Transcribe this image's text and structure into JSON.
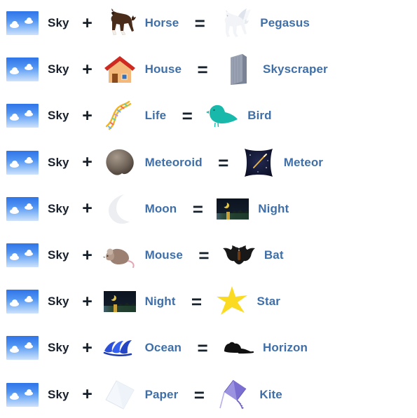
{
  "page": {
    "background_color": "#ffffff",
    "base_text_color": "#17202b",
    "link_text_color": "#3f6fa8",
    "operator_plus": "+",
    "operator_equals": "=",
    "base_element_label": "Sky",
    "base_element_icon": "sky-icon"
  },
  "recipes": [
    {
      "left_label": "Sky",
      "left_icon": "sky-icon",
      "plus": "+",
      "right_label": "Horse",
      "right_icon": "horse-icon",
      "equals": "=",
      "result_label": "Pegasus",
      "result_icon": "pegasus-icon"
    },
    {
      "left_label": "Sky",
      "left_icon": "sky-icon",
      "plus": "+",
      "right_label": "House",
      "right_icon": "house-icon",
      "equals": "=",
      "result_label": "Skyscraper",
      "result_icon": "skyscraper-icon"
    },
    {
      "left_label": "Sky",
      "left_icon": "sky-icon",
      "plus": "+",
      "right_label": "Life",
      "right_icon": "dna-life-icon",
      "equals": "=",
      "result_label": "Bird",
      "result_icon": "bird-icon"
    },
    {
      "left_label": "Sky",
      "left_icon": "sky-icon",
      "plus": "+",
      "right_label": "Meteoroid",
      "right_icon": "meteoroid-icon",
      "equals": "=",
      "result_label": "Meteor",
      "result_icon": "meteor-icon"
    },
    {
      "left_label": "Sky",
      "left_icon": "sky-icon",
      "plus": "+",
      "right_label": "Moon",
      "right_icon": "moon-icon",
      "equals": "=",
      "result_label": "Night",
      "result_icon": "night-icon"
    },
    {
      "left_label": "Sky",
      "left_icon": "sky-icon",
      "plus": "+",
      "right_label": "Mouse",
      "right_icon": "mouse-icon",
      "equals": "=",
      "result_label": "Bat",
      "result_icon": "bat-icon"
    },
    {
      "left_label": "Sky",
      "left_icon": "sky-icon",
      "plus": "+",
      "right_label": "Night",
      "right_icon": "night-icon",
      "equals": "=",
      "result_label": "Star",
      "result_icon": "star-icon"
    },
    {
      "left_label": "Sky",
      "left_icon": "sky-icon",
      "plus": "+",
      "right_label": "Ocean",
      "right_icon": "ocean-icon",
      "equals": "=",
      "result_label": "Horizon",
      "result_icon": "horizon-icon"
    },
    {
      "left_label": "Sky",
      "left_icon": "sky-icon",
      "plus": "+",
      "right_label": "Paper",
      "right_icon": "paper-icon",
      "equals": "=",
      "result_label": "Kite",
      "result_icon": "kite-icon"
    }
  ]
}
